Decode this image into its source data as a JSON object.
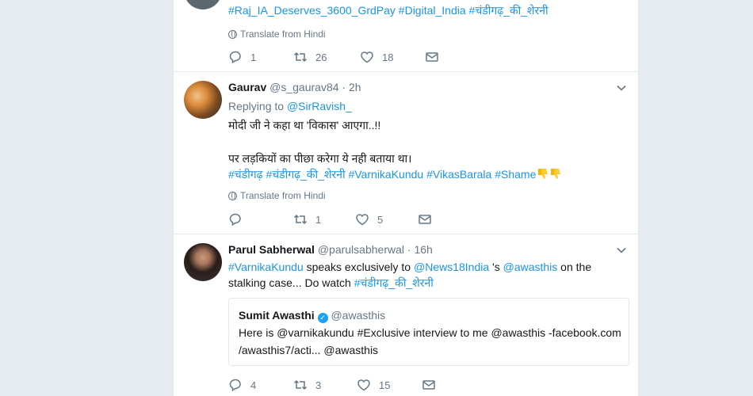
{
  "tweet0": {
    "text_parts": [
      "#Raj_IA_Deserves_3600_GrdPay",
      " ",
      "#Digital_India",
      " ",
      "#चंडीगढ़_की_शेरनी"
    ],
    "translate": "Translate from Hindi",
    "actions": {
      "replies": "1",
      "retweets": "26",
      "likes": "18"
    }
  },
  "tweet1": {
    "name": "Gaurav",
    "handle": "@s_gaurav84",
    "sep": "·",
    "time": "2h",
    "replying_prefix": "Replying to",
    "replying_to": "@SirRavish_",
    "line1": "मोदी जी ने कहा था 'विकास' आएगा..!!",
    "line2": "पर लड़कियों का पीछा करेगा ये नही बताया था।",
    "tags": [
      "#चंडीगढ़",
      "#चंडीगढ़_की_शेरनी",
      "#VarnikaKundu",
      "#VikasBarala",
      "#Shame"
    ],
    "translate": "Translate from Hindi",
    "actions": {
      "replies": "",
      "retweets": "1",
      "likes": "5"
    }
  },
  "tweet2": {
    "name": "Parul Sabherwal",
    "handle": "@parulsabherwal",
    "sep": "·",
    "time": "16h",
    "line1_parts": [
      "#VarnikaKundu",
      " speaks exclusively to ",
      "@News18India",
      " 's ",
      "@awasthis",
      " on the"
    ],
    "line2_text": "stalking case... Do watch ",
    "line2_tag": "#चंडीगढ़_की_शेरनी",
    "quote": {
      "name": "Sumit Awasthi",
      "handle": "@awasthis",
      "line1": "Here is @varnikakundu #Exclusive interview to me @awasthis -facebook.com",
      "line2": "/awasthis7/acti... @awasthis"
    },
    "actions": {
      "replies": "4",
      "retweets": "3",
      "likes": "15"
    }
  },
  "colors": {
    "link": "#1b95e0",
    "meta": "#657786",
    "background": "#e6ecf0"
  },
  "icons": {
    "reply": "reply-icon",
    "retweet": "retweet-icon",
    "like": "heart-icon",
    "dm": "envelope-icon",
    "more": "chevron-down-icon",
    "translate": "globe-icon"
  }
}
